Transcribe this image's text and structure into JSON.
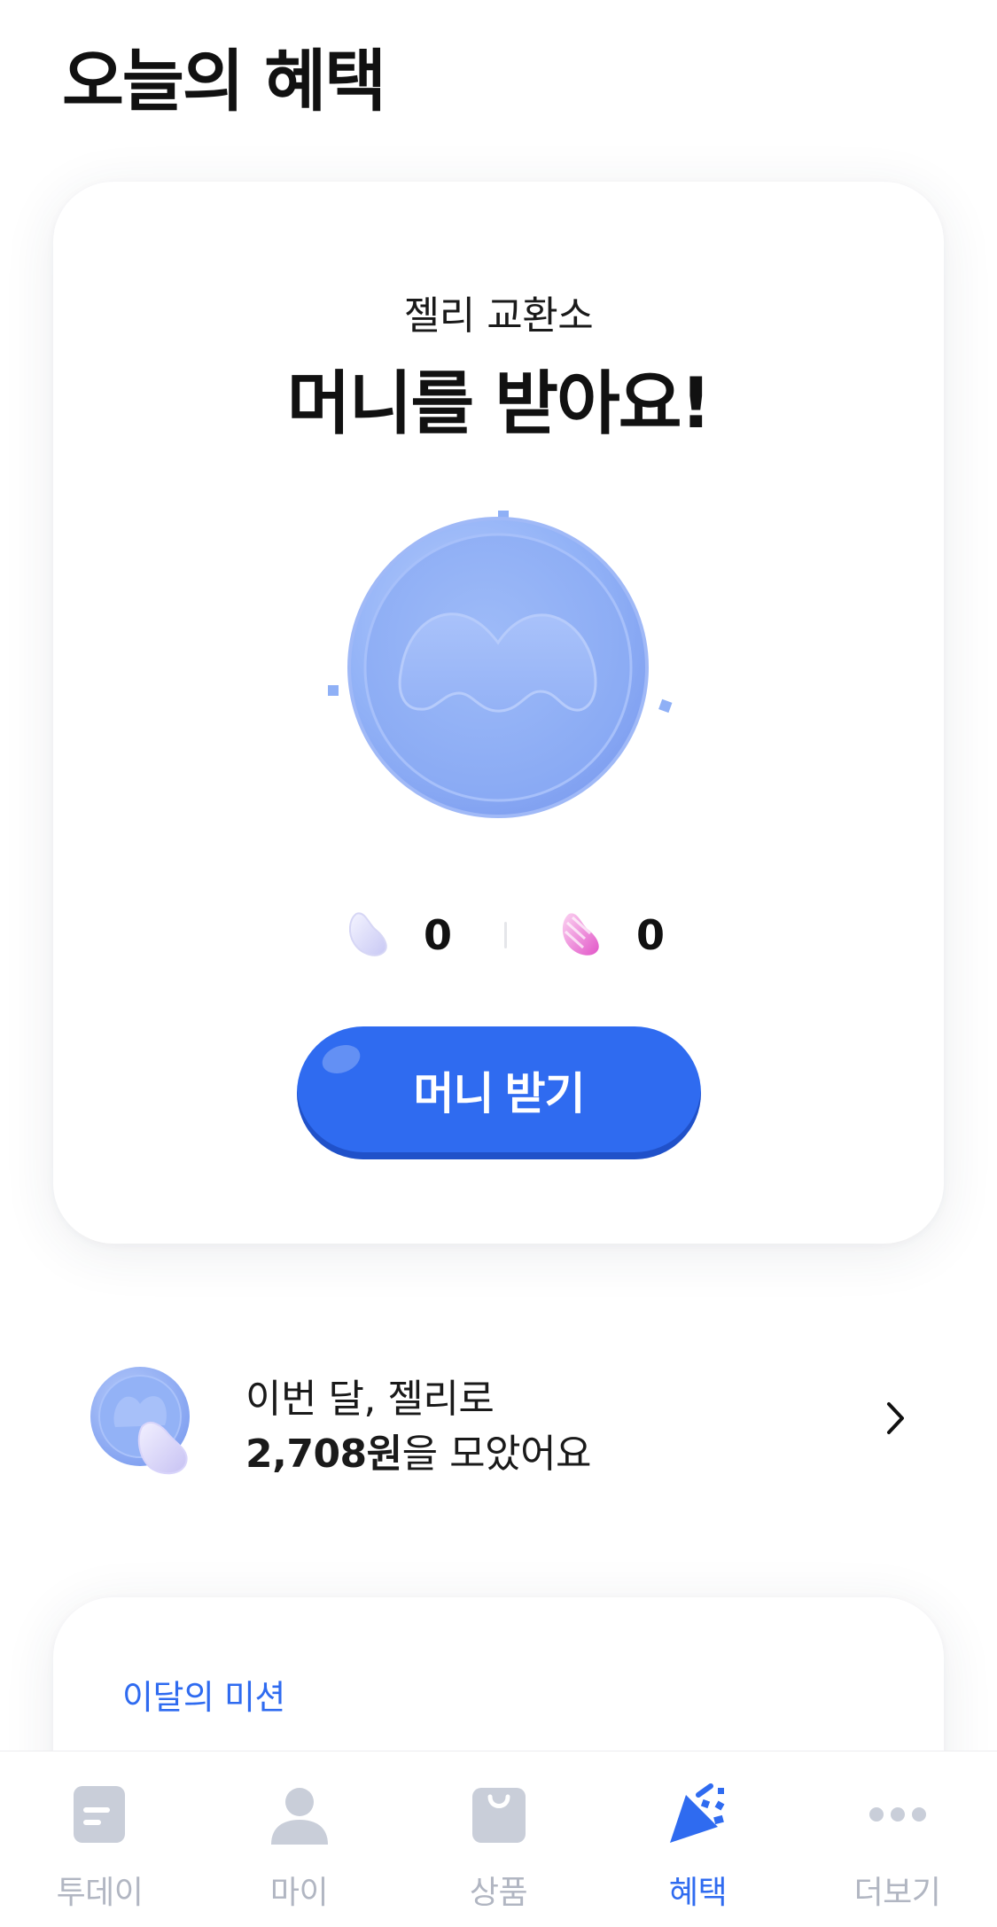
{
  "header": {
    "title": "오늘의 혜택"
  },
  "jelly_card": {
    "subtitle": "젤리 교환소",
    "headline": "머니를 받아요!",
    "counts": [
      {
        "icon": "white-jelly-icon",
        "value": "0"
      },
      {
        "icon": "pink-jelly-icon",
        "value": "0"
      }
    ],
    "button_label": "머니 받기"
  },
  "monthly": {
    "line1": "이번 달, 젤리로",
    "amount": "2,708원",
    "suffix": "을 모았어요"
  },
  "mission": {
    "title": "이달의 미션"
  },
  "tabbar": {
    "tabs": [
      {
        "label": "투데이",
        "icon": "today-icon",
        "active": false
      },
      {
        "label": "마이",
        "icon": "person-icon",
        "active": false
      },
      {
        "label": "상품",
        "icon": "bag-icon",
        "active": false
      },
      {
        "label": "혜택",
        "icon": "party-icon",
        "active": true
      },
      {
        "label": "더보기",
        "icon": "more-icon",
        "active": false
      }
    ]
  },
  "colors": {
    "accent": "#2f6bf0",
    "coin": "#8fb0f6",
    "inactive": "#b1b6c2"
  }
}
